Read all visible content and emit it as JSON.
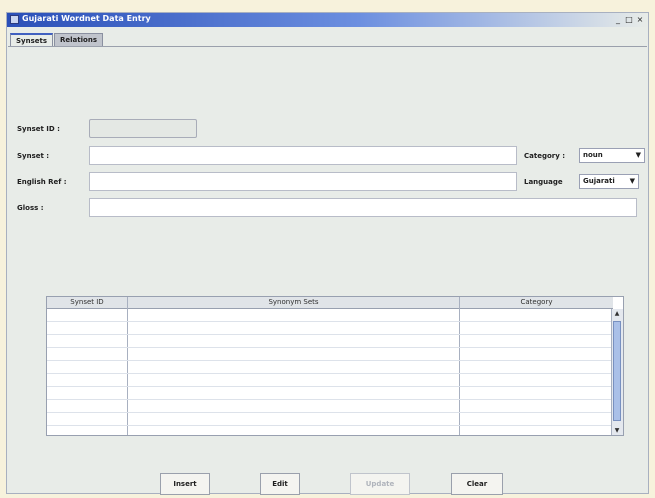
{
  "window": {
    "title": "Gujarati Wordnet Data Entry",
    "controls": [
      "_",
      "□",
      "×"
    ]
  },
  "tabs": [
    "Synsets",
    "Relations"
  ],
  "form": {
    "synset_id_label": "Synset ID :",
    "synset_label": "Synset :",
    "english_ref_label": "English Ref :",
    "gloss_label": "Gloss :",
    "category_label": "Category :",
    "category_value": "noun",
    "language_label": "Language",
    "language_value": "Gujarati"
  },
  "table": {
    "columns": [
      "Synset ID",
      "Synonym Sets",
      "Category"
    ],
    "rows": []
  },
  "buttons": {
    "insert": "Insert",
    "edit": "Edit",
    "update": "Update",
    "clear": "Clear"
  }
}
